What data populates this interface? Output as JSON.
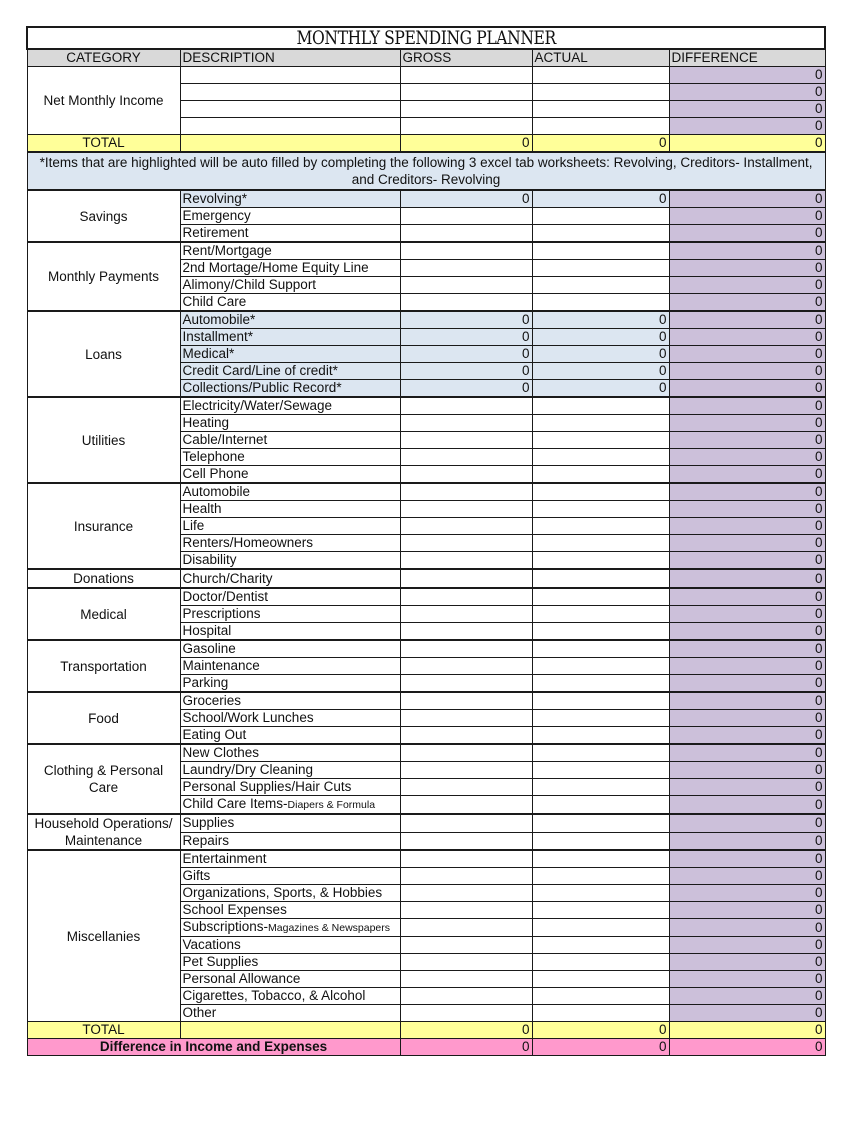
{
  "title": "MONTHLY SPENDING PLANNER",
  "columns": [
    "CATEGORY",
    "DESCRIPTION",
    "GROSS",
    "ACTUAL",
    "DIFFERENCE"
  ],
  "colors": {
    "header": "#d9d9d9",
    "difference": "#ccc0da",
    "highlight": "#dce6f1",
    "total": "#ffff99",
    "grand_total": "#ff99cc"
  },
  "income": {
    "category": "Net Monthly Income",
    "rows": [
      {
        "description": "",
        "gross": "",
        "actual": "",
        "difference": "0"
      },
      {
        "description": "",
        "gross": "",
        "actual": "",
        "difference": "0"
      },
      {
        "description": "",
        "gross": "",
        "actual": "",
        "difference": "0"
      },
      {
        "description": "",
        "gross": "",
        "actual": "",
        "difference": "0"
      }
    ],
    "total": {
      "label": "TOTAL",
      "description": "",
      "gross": "0",
      "actual": "0",
      "difference": "0"
    }
  },
  "note": "*Items that are highlighted will be auto filled by completing the following 3 excel tab worksheets: Revolving, Creditors- Installment, and Creditors- Revolving",
  "sections": [
    {
      "category": "Savings",
      "rows": [
        {
          "description": "Revolving*",
          "gross": "0",
          "actual": "0",
          "difference": "0",
          "highlight": true
        },
        {
          "description": "Emergency",
          "gross": "",
          "actual": "",
          "difference": "0"
        },
        {
          "description": "Retirement",
          "gross": "",
          "actual": "",
          "difference": "0"
        }
      ]
    },
    {
      "category": "Monthly Payments",
      "rows": [
        {
          "description": "Rent/Mortgage",
          "gross": "",
          "actual": "",
          "difference": "0"
        },
        {
          "description": "2nd Mortage/Home Equity Line",
          "gross": "",
          "actual": "",
          "difference": "0"
        },
        {
          "description": "Alimony/Child Support",
          "gross": "",
          "actual": "",
          "difference": "0"
        },
        {
          "description": "Child Care",
          "gross": "",
          "actual": "",
          "difference": "0"
        }
      ]
    },
    {
      "category": "Loans",
      "rows": [
        {
          "description": "Automobile*",
          "gross": "0",
          "actual": "0",
          "difference": "0",
          "highlight": true
        },
        {
          "description": "Installment*",
          "gross": "0",
          "actual": "0",
          "difference": "0",
          "highlight": true
        },
        {
          "description": "Medical*",
          "gross": "0",
          "actual": "0",
          "difference": "0",
          "highlight": true
        },
        {
          "description": "Credit Card/Line of credit*",
          "gross": "0",
          "actual": "0",
          "difference": "0",
          "highlight": true
        },
        {
          "description": "Collections/Public Record*",
          "gross": "0",
          "actual": "0",
          "difference": "0",
          "highlight": true
        }
      ]
    },
    {
      "category": "Utilities",
      "rows": [
        {
          "description": "Electricity/Water/Sewage",
          "gross": "",
          "actual": "",
          "difference": "0"
        },
        {
          "description": "Heating",
          "gross": "",
          "actual": "",
          "difference": "0"
        },
        {
          "description": "Cable/Internet",
          "gross": "",
          "actual": "",
          "difference": "0"
        },
        {
          "description": "Telephone",
          "gross": "",
          "actual": "",
          "difference": "0"
        },
        {
          "description": "Cell Phone",
          "gross": "",
          "actual": "",
          "difference": "0"
        }
      ]
    },
    {
      "category": "Insurance",
      "rows": [
        {
          "description": "Automobile",
          "gross": "",
          "actual": "",
          "difference": "0"
        },
        {
          "description": "Health",
          "gross": "",
          "actual": "",
          "difference": "0"
        },
        {
          "description": "Life",
          "gross": "",
          "actual": "",
          "difference": "0"
        },
        {
          "description": "Renters/Homeowners",
          "gross": "",
          "actual": "",
          "difference": "0"
        },
        {
          "description": "Disability",
          "gross": "",
          "actual": "",
          "difference": "0"
        }
      ]
    },
    {
      "category": "Donations",
      "rows": [
        {
          "description": "Church/Charity",
          "gross": "",
          "actual": "",
          "difference": "0"
        }
      ]
    },
    {
      "category": "Medical",
      "rows": [
        {
          "description": "Doctor/Dentist",
          "gross": "",
          "actual": "",
          "difference": "0"
        },
        {
          "description": "Prescriptions",
          "gross": "",
          "actual": "",
          "difference": "0"
        },
        {
          "description": "Hospital",
          "gross": "",
          "actual": "",
          "difference": "0"
        }
      ]
    },
    {
      "category": "Transportation",
      "rows": [
        {
          "description": "Gasoline",
          "gross": "",
          "actual": "",
          "difference": "0"
        },
        {
          "description": "Maintenance",
          "gross": "",
          "actual": "",
          "difference": "0"
        },
        {
          "description": "Parking",
          "gross": "",
          "actual": "",
          "difference": "0"
        }
      ]
    },
    {
      "category": "Food",
      "rows": [
        {
          "description": "Groceries",
          "gross": "",
          "actual": "",
          "difference": "0"
        },
        {
          "description": "School/Work Lunches",
          "gross": "",
          "actual": "",
          "difference": "0"
        },
        {
          "description": "Eating Out",
          "gross": "",
          "actual": "",
          "difference": "0"
        }
      ]
    },
    {
      "category": "Clothing & Personal Care",
      "rows": [
        {
          "description": "New Clothes",
          "gross": "",
          "actual": "",
          "difference": "0"
        },
        {
          "description": "Laundry/Dry Cleaning",
          "gross": "",
          "actual": "",
          "difference": "0"
        },
        {
          "description": "Personal Supplies/Hair Cuts",
          "gross": "",
          "actual": "",
          "difference": "0"
        },
        {
          "description": "Child Care Items-",
          "note": "Diapers & Formula",
          "gross": "",
          "actual": "",
          "difference": "0"
        }
      ]
    },
    {
      "category": "Household Operations/ Maintenance",
      "rows": [
        {
          "description": "Supplies",
          "gross": "",
          "actual": "",
          "difference": "0"
        },
        {
          "description": "Repairs",
          "gross": "",
          "actual": "",
          "difference": "0"
        }
      ]
    },
    {
      "category": "Miscellanies",
      "rows": [
        {
          "description": "Entertainment",
          "gross": "",
          "actual": "",
          "difference": "0"
        },
        {
          "description": "Gifts",
          "gross": "",
          "actual": "",
          "difference": "0"
        },
        {
          "description": "Organizations, Sports, & Hobbies",
          "gross": "",
          "actual": "",
          "difference": "0"
        },
        {
          "description": "School Expenses",
          "gross": "",
          "actual": "",
          "difference": "0"
        },
        {
          "description": "Subscriptions-",
          "note": "Magazines & Newspapers",
          "gross": "",
          "actual": "",
          "difference": "0"
        },
        {
          "description": "Vacations",
          "gross": "",
          "actual": "",
          "difference": "0"
        },
        {
          "description": "Pet Supplies",
          "gross": "",
          "actual": "",
          "difference": "0"
        },
        {
          "description": "Personal Allowance",
          "gross": "",
          "actual": "",
          "difference": "0"
        },
        {
          "description": "Cigarettes, Tobacco, & Alcohol",
          "gross": "",
          "actual": "",
          "difference": "0"
        },
        {
          "description": "Other",
          "gross": "",
          "actual": "",
          "difference": "0"
        }
      ]
    }
  ],
  "expense_total": {
    "label": "TOTAL",
    "description": "",
    "gross": "0",
    "actual": "0",
    "difference": "0"
  },
  "grand_total": {
    "label": "Difference in Income and Expenses",
    "gross": "0",
    "actual": "0",
    "difference": "0"
  }
}
